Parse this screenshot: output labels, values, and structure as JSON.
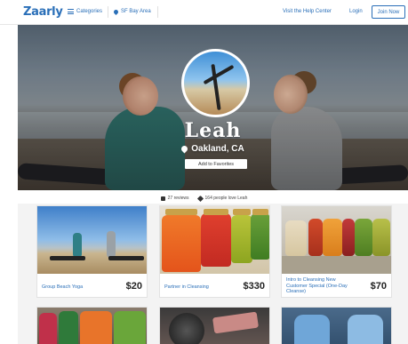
{
  "nav": {
    "logo": "Zaarly",
    "categories": "Categories",
    "location": "SF Bay Area",
    "help": "Visit the Help Center",
    "login": "Login",
    "join": "Join Now"
  },
  "profile": {
    "name": "Leah",
    "location": "Oakland, CA",
    "favorite_button": "Add to Favorites"
  },
  "stats": {
    "reviews": "27 reviews",
    "loves": "164 people love Leah"
  },
  "listings": [
    {
      "title": "Group Beach Yoga",
      "price": "$20"
    },
    {
      "title": "Partner in Cleansing",
      "price": "$330"
    },
    {
      "title": "Intro to Cleansing New Customer Special (One-Day Cleanse)",
      "price": "$70"
    }
  ],
  "colors": {
    "brand": "#2a6fb8"
  }
}
